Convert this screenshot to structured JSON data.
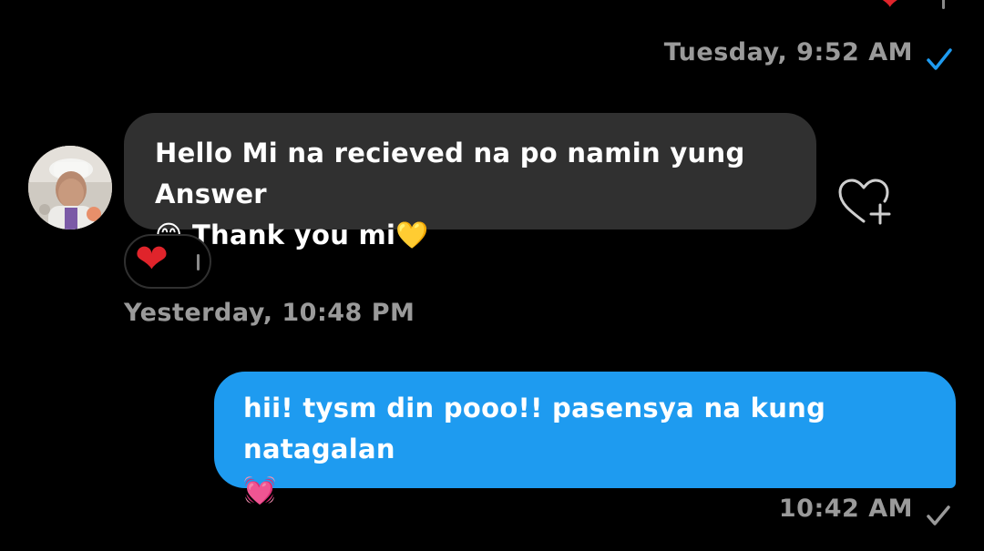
{
  "conversation": {
    "top_reaction": "❤",
    "tuesday_timestamp": "Tuesday, 9:52 AM",
    "incoming": {
      "text_line1": "Hello Mi na recieved na po namin yung Answer",
      "text_line2_emoji_start": "😊",
      "text_line2": " Thank you mi",
      "text_line2_emoji_end": "💛",
      "reaction": "❤"
    },
    "yesterday_timestamp": "Yesterday, 10:48 PM",
    "outgoing": {
      "text_line1": "hii! tysm din pooo!! pasensya na kung natagalan",
      "text_line2_emoji": "💓",
      "timestamp": "10:42 AM"
    }
  },
  "colors": {
    "background": "#000000",
    "incoming_bubble": "#303030",
    "outgoing_bubble": "#1e9bf0",
    "timestamp": "#9a9a9a",
    "read_check": "#1e9bf0",
    "sent_check": "#9a9a9a",
    "reaction_heart": "#e0242b"
  },
  "icons": {
    "tuesday_status": "blue-check-icon",
    "outgoing_status": "gray-check-icon",
    "react": "heart-plus-icon",
    "avatar": "contact-avatar"
  }
}
